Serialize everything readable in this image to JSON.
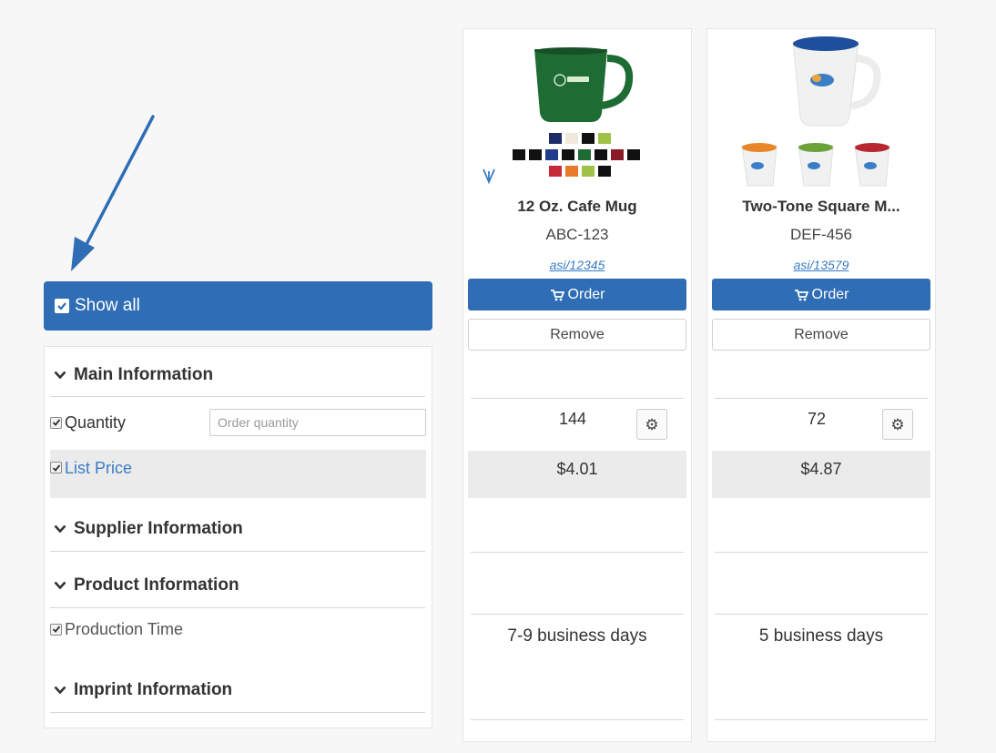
{
  "show_all": {
    "label": "Show all",
    "checked": true
  },
  "sections": {
    "main": "Main Information",
    "supplier": "Supplier Information",
    "product": "Product Information",
    "imprint": "Imprint Information"
  },
  "fields": {
    "quantity": {
      "label": "Quantity",
      "placeholder": "Order quantity",
      "checked": true
    },
    "list_price": {
      "label": "List Price",
      "checked": true
    },
    "production_time": {
      "label": "Production Time",
      "checked": true
    }
  },
  "products": [
    {
      "name": "12 Oz. Cafe Mug",
      "code": "ABC-123",
      "asi": "asi/12345",
      "order_label": "Order",
      "remove_label": "Remove",
      "quantity": "144",
      "price": "$4.01",
      "production_time": "7-9 business days",
      "mug_color": "#1f6b34"
    },
    {
      "name": "Two-Tone Square M...",
      "code": "DEF-456",
      "asi": "asi/13579",
      "order_label": "Order",
      "remove_label": "Remove",
      "quantity": "72",
      "price": "$4.87",
      "production_time": "5 business days",
      "mug_color": "#1e4f9c"
    }
  ],
  "colors": {
    "primary": "#2f6db5",
    "link": "#3a7cc4",
    "arrow": "#2f6db5"
  }
}
